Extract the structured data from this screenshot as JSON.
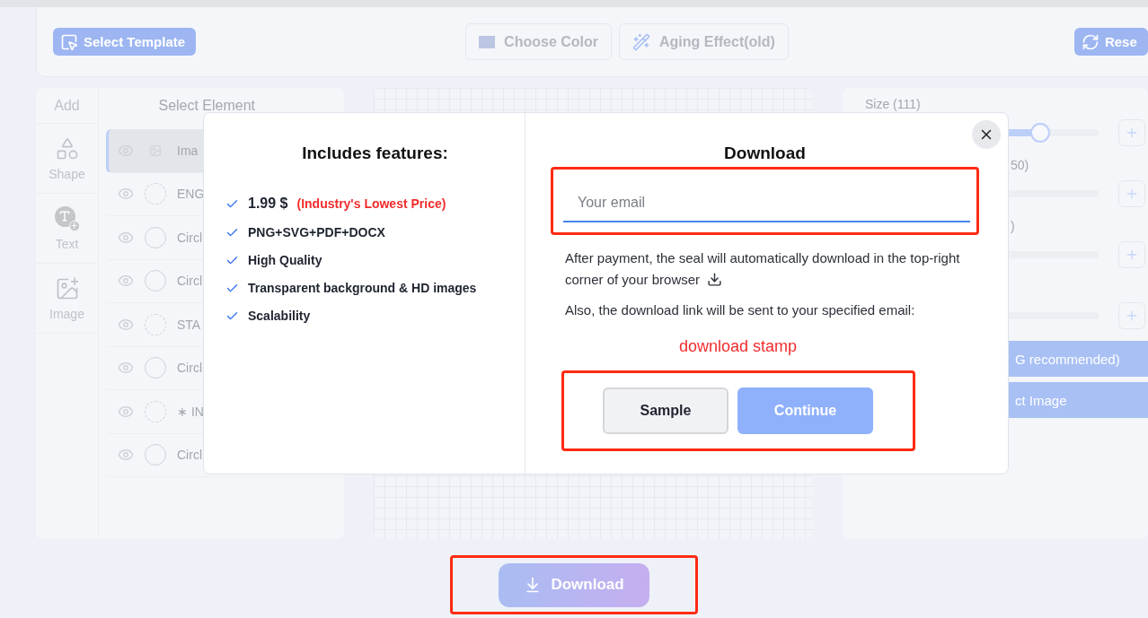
{
  "toolbar": {
    "select_template": "Select Template",
    "choose_color": "Choose Color",
    "aging_effect": "Aging Effect(old)",
    "reset": "Rese"
  },
  "add_panel": {
    "title": "Add",
    "items": [
      {
        "kind": "shape",
        "label": "Shape"
      },
      {
        "kind": "text",
        "label": "Text"
      },
      {
        "kind": "image",
        "label": "Image"
      }
    ]
  },
  "element_panel": {
    "title": "Select Element",
    "items": [
      {
        "kind": "image",
        "label": "Ima",
        "selected": true
      },
      {
        "kind": "dashed",
        "label": "ENG",
        "selected": false
      },
      {
        "kind": "solid",
        "label": "Circl",
        "selected": false
      },
      {
        "kind": "solid",
        "label": "Circl",
        "selected": false
      },
      {
        "kind": "dashed",
        "label": "STA",
        "selected": false
      },
      {
        "kind": "solid",
        "label": "Circl",
        "selected": false
      },
      {
        "kind": "dashed",
        "label": "∗ IN",
        "selected": false
      },
      {
        "kind": "solid",
        "label": "Circl",
        "selected": false
      }
    ]
  },
  "settings_panel": {
    "sliders": [
      {
        "kind": "full",
        "label": "Size (111)",
        "level": 0.75
      },
      {
        "kind": "cut",
        "label": "50)",
        "level": 0.55
      },
      {
        "kind": "cut",
        "label": ")",
        "level": 0.55
      },
      {
        "level": 0.05
      }
    ],
    "buttons": [
      "G recommended)",
      "ct Image"
    ]
  },
  "modal": {
    "features_title": "Includes features:",
    "features": [
      {
        "text": "1.99 $",
        "note": "(Industry's Lowest Price)"
      },
      {
        "text": "PNG+SVG+PDF+DOCX"
      },
      {
        "text": "High Quality"
      },
      {
        "text": "Transparent background & HD images"
      },
      {
        "text": "Scalability"
      }
    ],
    "download_title": "Download",
    "email": {
      "placeholder": "Your email"
    },
    "info_1": "After payment, the seal will automatically download in the top-right corner of your browser",
    "info_2": "Also, the download link will be sent to your specified email:",
    "annotation": "download stamp",
    "buttons": {
      "sample": "Sample",
      "continue": "Continue"
    }
  },
  "download_button": "Download"
}
